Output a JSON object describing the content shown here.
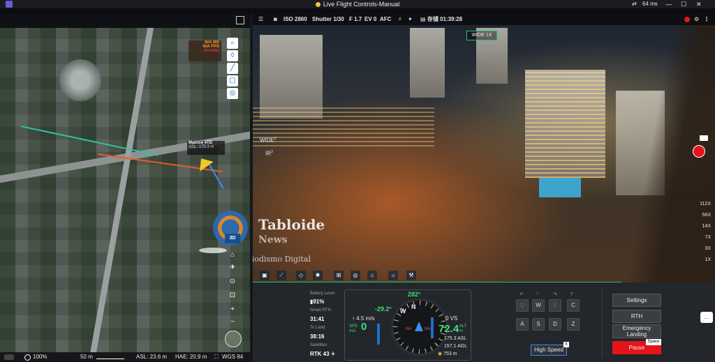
{
  "window": {
    "title": "Live Flight Controls-Manual",
    "ping": "64 ms"
  },
  "map": {
    "speed_ms": "N/A MS",
    "speed_fps": "N/A FPS",
    "throttle": "(throttle)",
    "drone_name": "Matrice 4TD",
    "drone_asl": "ASL: 175.3 m",
    "dock_label": "3D",
    "zoom_pct": "100%",
    "scale": "50 m",
    "asl": "ASL: 23.6 m",
    "hae": "HAE: 20.9 m",
    "datum": "WGS 84"
  },
  "camera": {
    "iso": "ISO 2860",
    "shutter": "Shutter 1/30",
    "fstop": "F 1.7",
    "ev": "EV 0",
    "focus": "AFC",
    "storage": "存储",
    "time": "01:39:28",
    "lens_badge": "WIDE 1X",
    "wide": "WIDE",
    "ir": "IR",
    "wide_num": "2",
    "ir_num": "3",
    "zoom_levels": [
      "112X",
      "56X",
      "14X",
      "7X",
      "3X",
      "1X"
    ]
  },
  "watermark": {
    "brand": "Tabloide",
    "sub": "News",
    "tag": "Periodismo Digital"
  },
  "telemetry": {
    "battery_label": "Battery Level",
    "battery": "91%",
    "smart_rth_label": "Smart RTH",
    "smart_rth": "31:41",
    "to_land_label": "To Land",
    "to_land": "38:16",
    "sat_label": "Satellites",
    "sat": "RTK 43",
    "heading": "282°",
    "pitch": "-29.2°",
    "hs": "↑ 4.5 m/s",
    "spd_label": "SPD m/s",
    "spd": "0",
    "vs": "0 VS",
    "alt_label": "ALT m",
    "alt": "72.4",
    "asl": "175.3 ASL",
    "hae": "157.1 AGL",
    "dist": "753 m",
    "na_left": "NA",
    "na_right": "NA",
    "compass_w": "W",
    "compass_n": "N"
  },
  "keys": {
    "q": "Q",
    "w": "W",
    "e": "E",
    "c": "C",
    "a": "A",
    "s": "S",
    "d": "D",
    "z": "Z",
    "high_speed": "High Speed",
    "space": "Space"
  },
  "buttons": {
    "settings": "Settings",
    "rth": "RTH",
    "emergency": "Emergency Landing",
    "pause": "Pause"
  },
  "colors": {
    "accent": "#1fbf7a",
    "pause": "#e5141b",
    "heading": "#3ee07a"
  }
}
